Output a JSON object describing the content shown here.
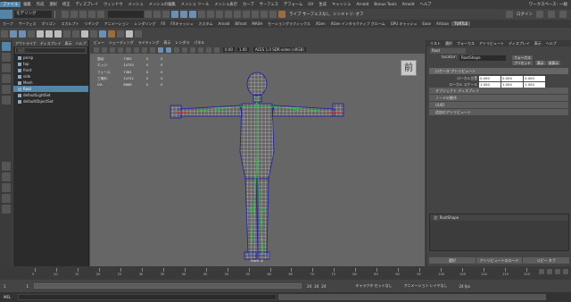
{
  "menubar": {
    "items": [
      "ファイル",
      "編集",
      "作成",
      "選択",
      "修正",
      "ディスプレイ",
      "ウィンドウ",
      "メッシュ",
      "メッシュの編集",
      "メッシュ ツール",
      "メッシュ表示",
      "カーブ",
      "サーフェス",
      "デフォーム",
      "UV",
      "生成",
      "キャッシュ",
      "Arnold",
      "Bonus Tools",
      "Arnold",
      "ヘルプ"
    ],
    "workspace_label": "ワークスペース:",
    "workspace_value": "一般"
  },
  "statusline": {
    "menuset": "モデリング",
    "live_label": "ライブ サーフェスなし",
    "symmetry": "シンメトリ: オフ",
    "login": "ログイン"
  },
  "shelf_tabs": [
    "カーブ",
    "サーフェス",
    "ポリゴン",
    "スカルプト",
    "リギング",
    "アニメーション",
    "レンダリング",
    "FX",
    "FXキャッシュ",
    "カスタム",
    "Arnold",
    "Bifrost",
    "MASH",
    "モーショングラフィックス",
    "XGen",
    "XGen インタラクティブ グルーム",
    "GPU キャッシュ",
    "Ease",
    "Artisan",
    "TURTLE"
  ],
  "shelf_selected": "TURTLE",
  "outliner": {
    "menu": [
      "アウトライナ",
      "ディスプレイ",
      "表示",
      "ヘルプ"
    ],
    "search_placeholder": "検索...",
    "items": [
      {
        "label": "persp",
        "icon": "camera-icon"
      },
      {
        "label": "top",
        "icon": "camera-icon"
      },
      {
        "label": "front",
        "icon": "camera-icon"
      },
      {
        "label": "side",
        "icon": "camera-icon"
      },
      {
        "label": "Mesh",
        "icon": "mesh-icon"
      },
      {
        "label": "Root",
        "icon": "joint-icon"
      },
      {
        "label": "defaultLightSet",
        "icon": "set-icon"
      },
      {
        "label": "defaultObjectSet",
        "icon": "set-icon"
      }
    ],
    "selected_index": 5
  },
  "viewport": {
    "menu": [
      "ビュー",
      "シェーディング",
      "ライティング",
      "表示",
      "レンダラ",
      "パネル"
    ],
    "field1": "0.00",
    "field2": "1.00",
    "colorspace": "ACES 1.0 SDR-video (sRGB)",
    "camera": "front -X",
    "watermark": "前",
    "hud": [
      {
        "label": "頂点:",
        "v1": "7383",
        "v2": "0",
        "v3": "0"
      },
      {
        "label": "エッジ:",
        "v1": "14753",
        "v2": "0",
        "v3": "0"
      },
      {
        "label": "フェース:",
        "v1": "7362",
        "v2": "0",
        "v3": "0"
      },
      {
        "label": "三角形:",
        "v1": "14722",
        "v2": "0",
        "v3": "0"
      },
      {
        "label": "UV:",
        "v1": "8866",
        "v2": "0",
        "v3": "0"
      }
    ]
  },
  "channelbox": {
    "tabs": [
      "リスト",
      "選択",
      "フォーカス",
      "アトリビュート",
      "ディスプレイ",
      "表示",
      "ヘルプ"
    ],
    "node_tab": "Root",
    "shape_tab": "RootShape",
    "locator_label": "locator:",
    "locator_value": "RootShape",
    "buttons": [
      "フォーカス",
      "プリセット",
      "表示",
      "非表示"
    ],
    "section_open": "ロケータ アトリビュート",
    "rows": [
      {
        "label": "ローカル位置",
        "values": [
          "0.000",
          "0.000",
          "0.000"
        ]
      },
      {
        "label": "ローカル スケール",
        "values": [
          "1.000",
          "1.000",
          "1.000"
        ]
      }
    ],
    "sections": [
      "オブジェクト ディスプレイ",
      "ノードの動作",
      "UUID",
      "追加のアトリビュート"
    ],
    "notes_label": "注: RootShape",
    "bottom_buttons": [
      "選択",
      "アトリビュートのロード",
      "コピー タブ"
    ]
  },
  "timeline": {
    "ticks": [
      5,
      10,
      15,
      20,
      25,
      30,
      35,
      40,
      45,
      50,
      55,
      60,
      65,
      70,
      75,
      80,
      85,
      90,
      95,
      100,
      105,
      110,
      115,
      120
    ]
  },
  "range": {
    "start": "1",
    "start2": "1",
    "end": "24",
    "end2": "24",
    "end3": "24",
    "char_set": "キャラクタ セットなし",
    "anim_layer": "アニメーション レイヤなし",
    "fps": "24 fps"
  },
  "cmdline": {
    "label": "MEL"
  }
}
